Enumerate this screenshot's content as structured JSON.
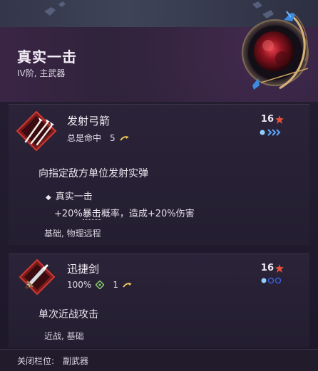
{
  "item": {
    "title": "真实一击",
    "subtitle": "IV阶, 主武器"
  },
  "skills": [
    {
      "name": "发射弓箭",
      "stat": "总是命中",
      "stat_value": "5",
      "cost": "16",
      "description": "向指定敌方单位发射实弹",
      "bullet_title": "真实一击",
      "bullet_detail_pre": "+20%",
      "bullet_detail_link": "暴击",
      "bullet_detail_post": "概率，造成+20%伤害",
      "tags": "基础, 物理远程"
    },
    {
      "name": "迅捷剑",
      "stat": "100%",
      "stat_value": "1",
      "cost": "16",
      "description": "单次近战攻击",
      "tags": "近战, 基础"
    }
  ],
  "footer": {
    "label": "关闭栏位:",
    "value": "副武器"
  },
  "colors": {
    "accent_red": "#c8322a",
    "pip_blue": "#5aa8ff",
    "gold": "#e9c15a"
  },
  "icons": [
    "arrows-icon",
    "sword-icon",
    "crimson-orb-badge-icon",
    "cost-burst-icon",
    "range-arrow-icon",
    "accuracy-icon"
  ]
}
